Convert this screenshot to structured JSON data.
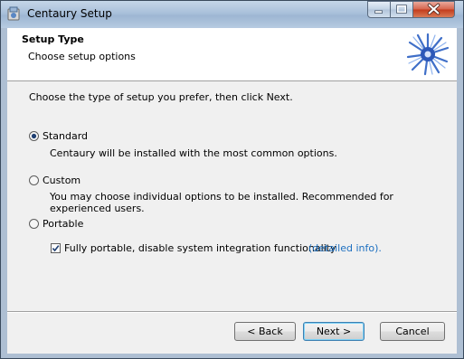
{
  "window": {
    "title": "Centaury Setup",
    "icons": {
      "app": "installer-icon",
      "minimize": "minimize-icon",
      "maximize": "maximize-icon",
      "close": "close-icon"
    }
  },
  "header": {
    "title": "Setup Type",
    "subtitle": "Choose setup options",
    "logo": "cornflower-logo"
  },
  "instruction": "Choose the type of setup you prefer, then click Next.",
  "options": [
    {
      "label": "Standard",
      "description": "Centaury will be installed with the most common options.",
      "selected": true
    },
    {
      "label": "Custom",
      "description": "You may choose individual options to be installed. Recommended for experienced users.",
      "selected": false
    },
    {
      "label": "Portable",
      "description": "",
      "selected": false
    }
  ],
  "portable_checkbox": {
    "label": "Fully portable, disable system integration functionality",
    "checked": true,
    "link": "(detailed info)."
  },
  "buttons": {
    "back": "< Back",
    "next": "Next >",
    "cancel": "Cancel"
  },
  "colors": {
    "link": "#1c6fc0",
    "titlebar": "#a9c0da",
    "close_button": "#c23a1c"
  }
}
